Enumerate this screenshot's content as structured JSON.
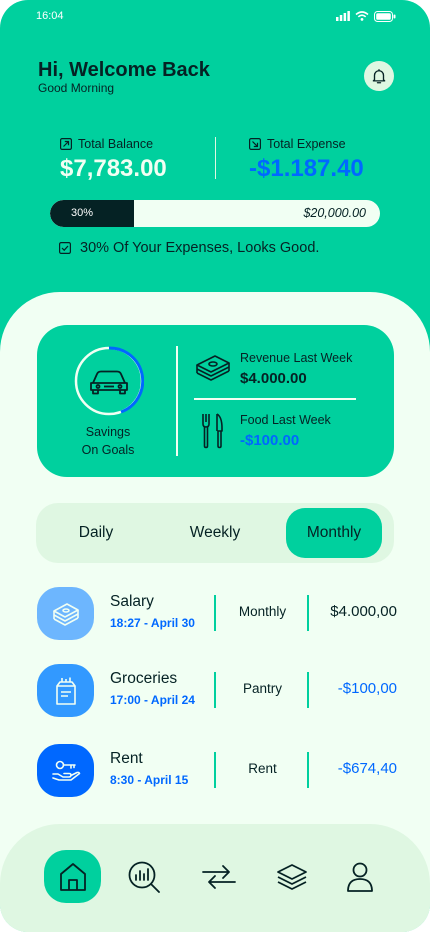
{
  "status": {
    "time": "16:04"
  },
  "header": {
    "title": "Hi, Welcome Back",
    "subtitle": "Good Morning",
    "bell_icon": "bell-icon"
  },
  "balance": {
    "total_balance_label": "Total Balance",
    "total_balance_value": "$7,783.00",
    "total_expense_label": "Total Expense",
    "total_expense_value": "-$1.187.40",
    "progress_percent_label": "30%",
    "progress_fraction": 0.3,
    "progress_max": "$20,000.00",
    "status_message": "30% Of Your Expenses, Looks Good."
  },
  "goal_card": {
    "savings_line1": "Savings",
    "savings_line2": "On Goals",
    "savings_icon": "car-icon",
    "revenue_label": "Revenue Last Week",
    "revenue_value": "$4.000.00",
    "revenue_icon": "cash-stack-icon",
    "food_label": "Food Last Week",
    "food_value": "-$100.00",
    "food_icon": "fork-knife-icon"
  },
  "tabs": [
    {
      "label": "Daily",
      "active": false
    },
    {
      "label": "Weekly",
      "active": false
    },
    {
      "label": "Monthly",
      "active": true
    }
  ],
  "transactions": [
    {
      "title": "Salary",
      "time": "18:27 - April 30",
      "category": "Monthly",
      "amount": "$4.000,00",
      "icon": "money-icon",
      "color": "#6DB6FE"
    },
    {
      "title": "Groceries",
      "time": "17:00 - April 24",
      "category": "Pantry",
      "amount": "-$100,00",
      "icon": "grocery-bag-icon",
      "color": "#3299FF"
    },
    {
      "title": "Rent",
      "time": "8:30 - April 15",
      "category": "Rent",
      "amount": "-$674,40",
      "icon": "key-hand-icon",
      "color": "#0068FF"
    }
  ],
  "nav": [
    {
      "name": "home-icon",
      "active": true
    },
    {
      "name": "analysis-icon",
      "active": false
    },
    {
      "name": "transfer-icon",
      "active": false
    },
    {
      "name": "layers-icon",
      "active": false
    },
    {
      "name": "profile-icon",
      "active": false
    }
  ],
  "colors": {
    "primary": "#00D09E",
    "dark": "#052224",
    "honeydew": "#F1FFF3",
    "light_green": "#DFF7E2",
    "ocean_blue": "#0068FF"
  }
}
